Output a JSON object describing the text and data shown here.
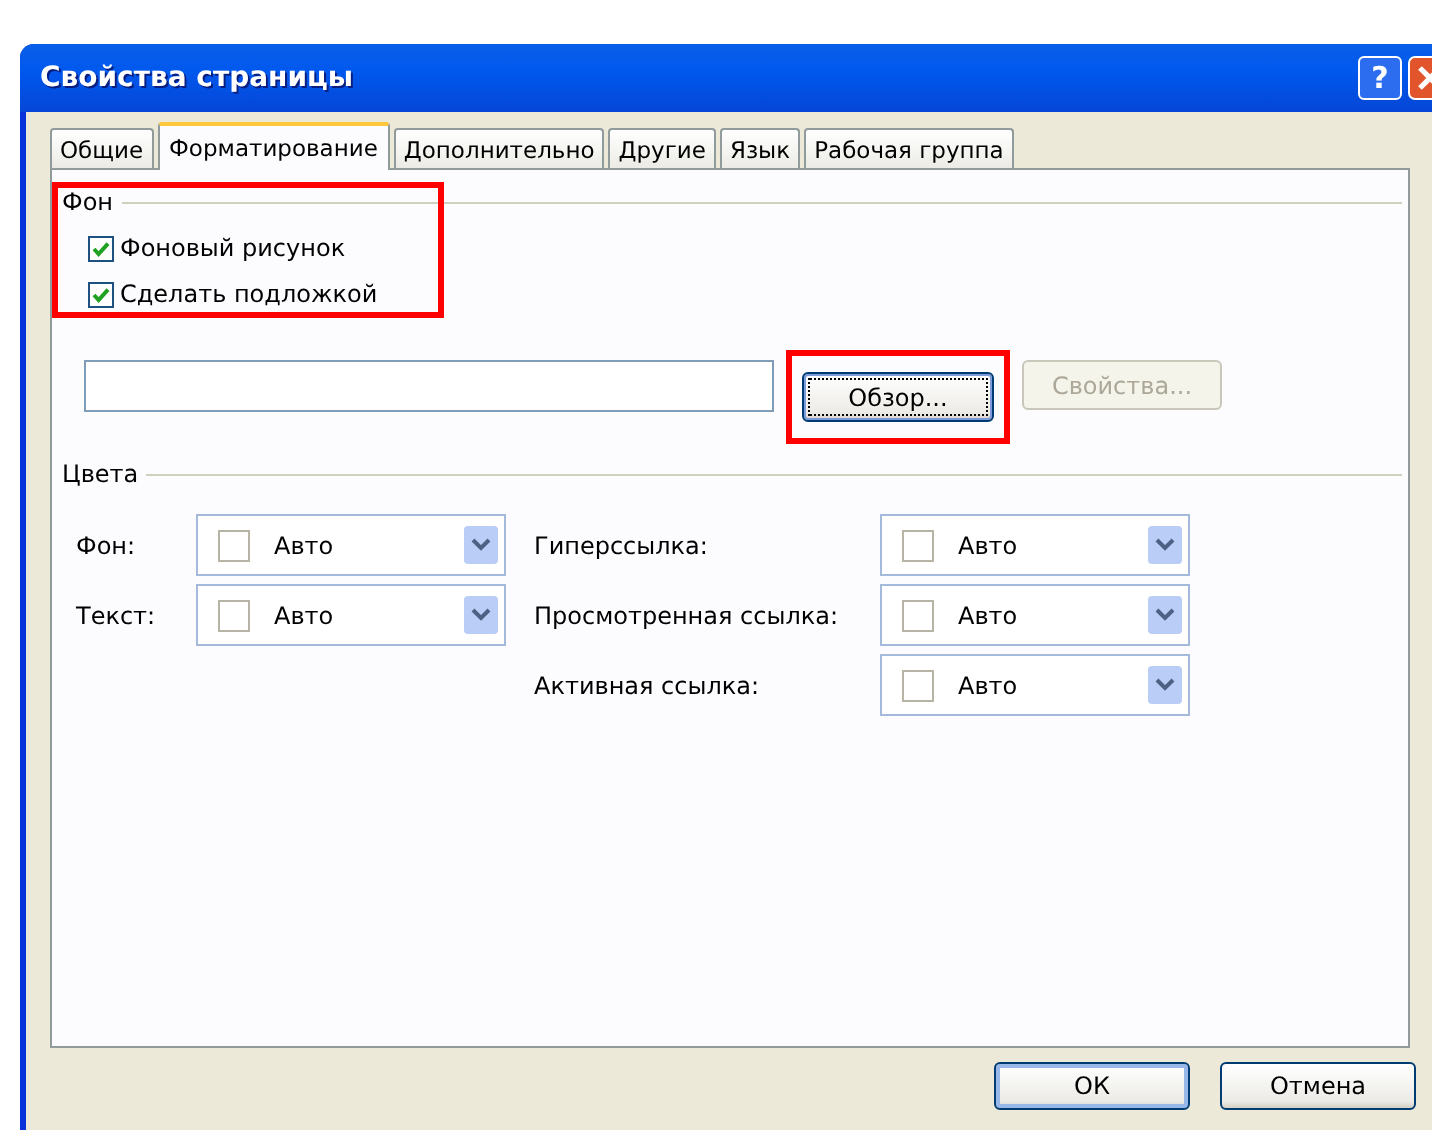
{
  "window": {
    "title": "Свойства страницы",
    "help_label": "?"
  },
  "tabs": [
    {
      "label": "Общие",
      "selected": false
    },
    {
      "label": "Форматирование",
      "selected": true
    },
    {
      "label": "Дополнительно",
      "selected": false
    },
    {
      "label": "Другие",
      "selected": false
    },
    {
      "label": "Язык",
      "selected": false
    },
    {
      "label": "Рабочая группа",
      "selected": false
    }
  ],
  "background_group": {
    "legend": "Фон",
    "highlighted": true,
    "checkboxes": [
      {
        "label": "Фоновый рисунок",
        "checked": true
      },
      {
        "label": "Сделать подложкой",
        "checked": true
      }
    ],
    "browse_button": {
      "label": "Обзор...",
      "highlighted": true,
      "disabled": false
    },
    "properties_button": {
      "label": "Свойства...",
      "disabled": true
    }
  },
  "colors_group": {
    "legend": "Цвета",
    "left": [
      {
        "label": "Фон:",
        "value": "Авто"
      },
      {
        "label": "Текст:",
        "value": "Авто"
      }
    ],
    "right": [
      {
        "label": "Гиперссылка:",
        "value": "Авто"
      },
      {
        "label": "Просмотренная ссылка:",
        "value": "Авто"
      },
      {
        "label": "Активная ссылка:",
        "value": "Авто"
      }
    ]
  },
  "buttons": [
    {
      "label": "ОК",
      "kind": "default"
    },
    {
      "label": "Отмена",
      "kind": "normal"
    }
  ]
}
